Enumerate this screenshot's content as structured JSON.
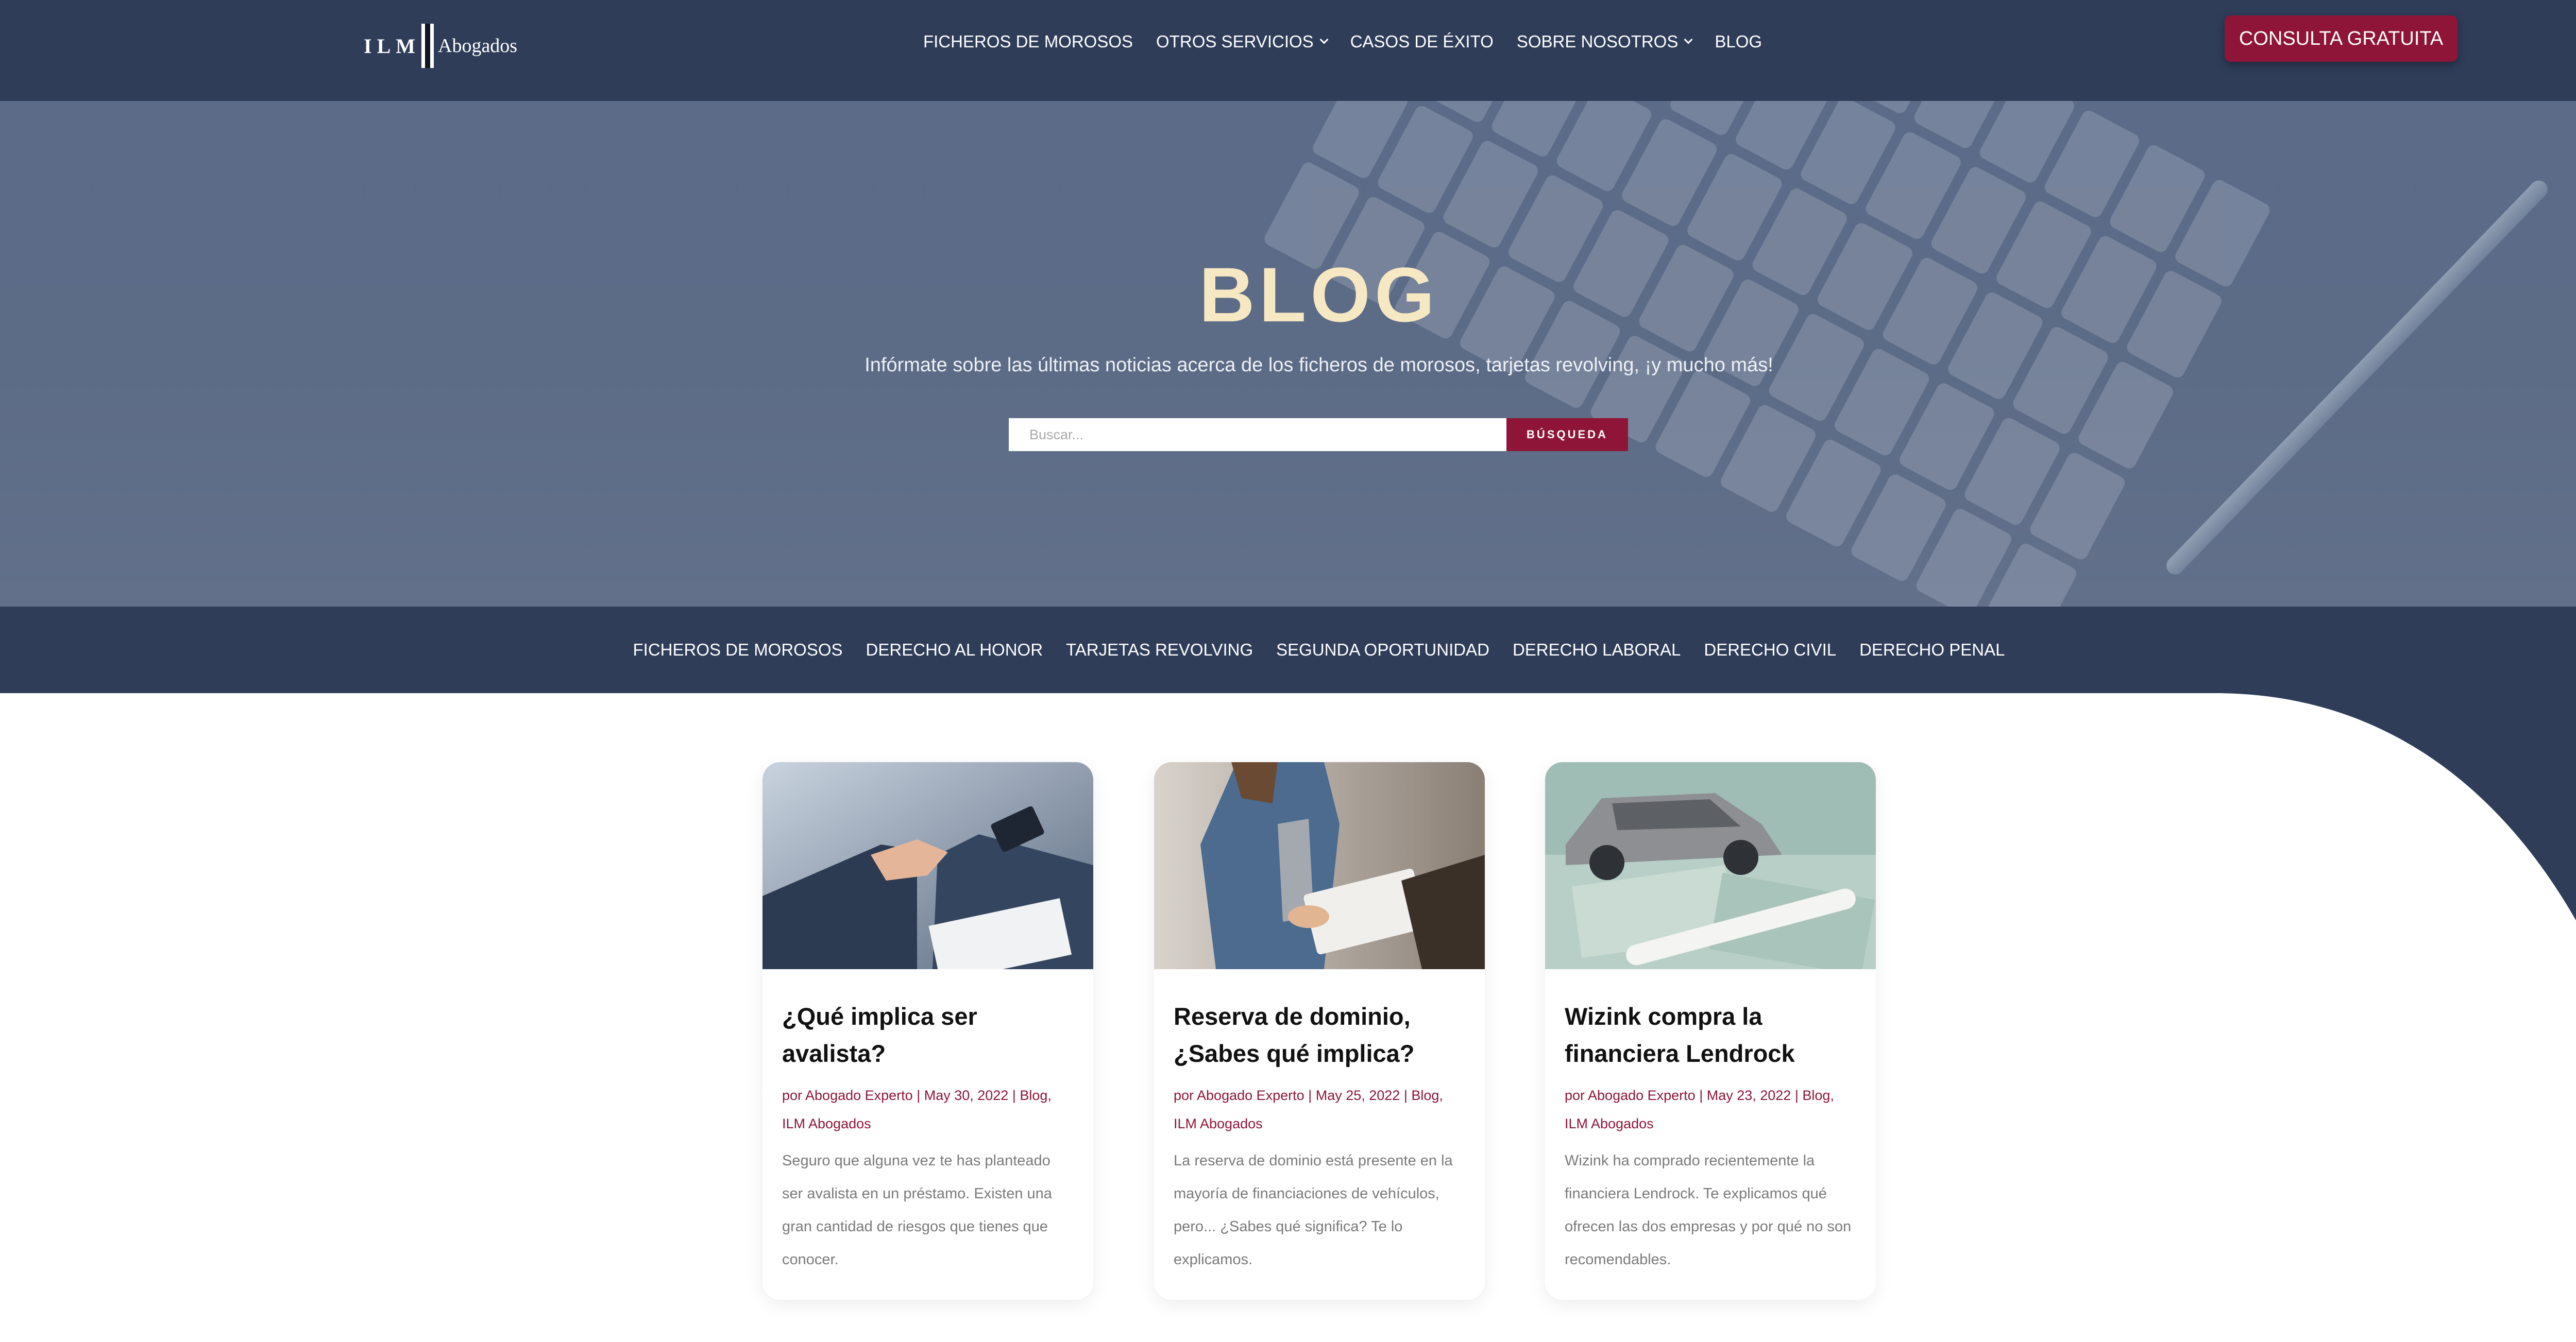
{
  "header": {
    "logo_text": "ILM",
    "logo_subtext": "Abogados",
    "nav": [
      {
        "label": "FICHEROS DE MOROSOS",
        "dropdown": false
      },
      {
        "label": "OTROS SERVICIOS",
        "dropdown": true
      },
      {
        "label": "CASOS DE ÉXITO",
        "dropdown": false
      },
      {
        "label": "SOBRE NOSOTROS",
        "dropdown": true
      },
      {
        "label": "BLOG",
        "dropdown": false
      }
    ],
    "cta_label": "CONSULTA GRATUITA"
  },
  "hero": {
    "title": "BLOG",
    "subtitle": "Infórmate sobre las últimas noticias acerca de los ficheros de morosos, tarjetas revolving, ¡y mucho más!",
    "search": {
      "placeholder": "Buscar...",
      "value": "",
      "button_label": "BÚSQUEDA"
    }
  },
  "categories": [
    "FICHEROS DE MOROSOS",
    "DERECHO AL HONOR",
    "TARJETAS REVOLVING",
    "SEGUNDA OPORTUNIDAD",
    "DERECHO LABORAL",
    "DERECHO CIVIL",
    "DERECHO PENAL"
  ],
  "posts": [
    {
      "title": "¿Qué implica ser avalista?",
      "meta": "por Abogado Experto | May 30, 2022 | Blog, ILM Abogados",
      "excerpt": "Seguro que alguna vez te has planteado ser avalista en un préstamo. Existen una gran cantidad de riesgos que tienes que conocer.",
      "image": "handshake-photo"
    },
    {
      "title": "Reserva de dominio, ¿Sabes qué implica?",
      "meta": "por Abogado Experto | May 25, 2022 | Blog, ILM Abogados",
      "excerpt": "La reserva de dominio está presente en la mayoría de financiaciones de vehículos, pero... ¿Sabes qué significa? Te lo explicamos.",
      "image": "signing-contract-photo"
    },
    {
      "title": "Wizink compra la financiera Lendrock",
      "meta": "por Abogado Experto | May 23, 2022 | Blog, ILM Abogados",
      "excerpt": "Wizink ha comprado recientemente la financiera Lendrock. Te explicamos qué ofrecen las dos empresas y por qué no son recomendables.",
      "image": "toy-car-on-money-photo"
    }
  ],
  "colors": {
    "navy": "#2f3d59",
    "accent": "#8e1538",
    "hero_title": "#f6e8c3"
  }
}
